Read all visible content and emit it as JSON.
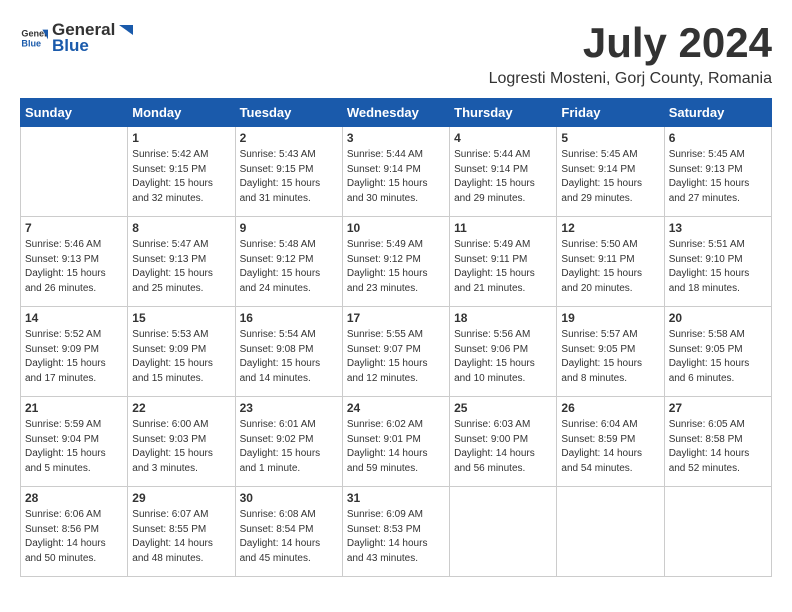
{
  "header": {
    "logo_general": "General",
    "logo_blue": "Blue",
    "month": "July 2024",
    "location": "Logresti Mosteni, Gorj County, Romania"
  },
  "days_of_week": [
    "Sunday",
    "Monday",
    "Tuesday",
    "Wednesday",
    "Thursday",
    "Friday",
    "Saturday"
  ],
  "weeks": [
    [
      {
        "day": "",
        "content": ""
      },
      {
        "day": "1",
        "content": "Sunrise: 5:42 AM\nSunset: 9:15 PM\nDaylight: 15 hours\nand 32 minutes."
      },
      {
        "day": "2",
        "content": "Sunrise: 5:43 AM\nSunset: 9:15 PM\nDaylight: 15 hours\nand 31 minutes."
      },
      {
        "day": "3",
        "content": "Sunrise: 5:44 AM\nSunset: 9:14 PM\nDaylight: 15 hours\nand 30 minutes."
      },
      {
        "day": "4",
        "content": "Sunrise: 5:44 AM\nSunset: 9:14 PM\nDaylight: 15 hours\nand 29 minutes."
      },
      {
        "day": "5",
        "content": "Sunrise: 5:45 AM\nSunset: 9:14 PM\nDaylight: 15 hours\nand 29 minutes."
      },
      {
        "day": "6",
        "content": "Sunrise: 5:45 AM\nSunset: 9:13 PM\nDaylight: 15 hours\nand 27 minutes."
      }
    ],
    [
      {
        "day": "7",
        "content": "Sunrise: 5:46 AM\nSunset: 9:13 PM\nDaylight: 15 hours\nand 26 minutes."
      },
      {
        "day": "8",
        "content": "Sunrise: 5:47 AM\nSunset: 9:13 PM\nDaylight: 15 hours\nand 25 minutes."
      },
      {
        "day": "9",
        "content": "Sunrise: 5:48 AM\nSunset: 9:12 PM\nDaylight: 15 hours\nand 24 minutes."
      },
      {
        "day": "10",
        "content": "Sunrise: 5:49 AM\nSunset: 9:12 PM\nDaylight: 15 hours\nand 23 minutes."
      },
      {
        "day": "11",
        "content": "Sunrise: 5:49 AM\nSunset: 9:11 PM\nDaylight: 15 hours\nand 21 minutes."
      },
      {
        "day": "12",
        "content": "Sunrise: 5:50 AM\nSunset: 9:11 PM\nDaylight: 15 hours\nand 20 minutes."
      },
      {
        "day": "13",
        "content": "Sunrise: 5:51 AM\nSunset: 9:10 PM\nDaylight: 15 hours\nand 18 minutes."
      }
    ],
    [
      {
        "day": "14",
        "content": "Sunrise: 5:52 AM\nSunset: 9:09 PM\nDaylight: 15 hours\nand 17 minutes."
      },
      {
        "day": "15",
        "content": "Sunrise: 5:53 AM\nSunset: 9:09 PM\nDaylight: 15 hours\nand 15 minutes."
      },
      {
        "day": "16",
        "content": "Sunrise: 5:54 AM\nSunset: 9:08 PM\nDaylight: 15 hours\nand 14 minutes."
      },
      {
        "day": "17",
        "content": "Sunrise: 5:55 AM\nSunset: 9:07 PM\nDaylight: 15 hours\nand 12 minutes."
      },
      {
        "day": "18",
        "content": "Sunrise: 5:56 AM\nSunset: 9:06 PM\nDaylight: 15 hours\nand 10 minutes."
      },
      {
        "day": "19",
        "content": "Sunrise: 5:57 AM\nSunset: 9:05 PM\nDaylight: 15 hours\nand 8 minutes."
      },
      {
        "day": "20",
        "content": "Sunrise: 5:58 AM\nSunset: 9:05 PM\nDaylight: 15 hours\nand 6 minutes."
      }
    ],
    [
      {
        "day": "21",
        "content": "Sunrise: 5:59 AM\nSunset: 9:04 PM\nDaylight: 15 hours\nand 5 minutes."
      },
      {
        "day": "22",
        "content": "Sunrise: 6:00 AM\nSunset: 9:03 PM\nDaylight: 15 hours\nand 3 minutes."
      },
      {
        "day": "23",
        "content": "Sunrise: 6:01 AM\nSunset: 9:02 PM\nDaylight: 15 hours\nand 1 minute."
      },
      {
        "day": "24",
        "content": "Sunrise: 6:02 AM\nSunset: 9:01 PM\nDaylight: 14 hours\nand 59 minutes."
      },
      {
        "day": "25",
        "content": "Sunrise: 6:03 AM\nSunset: 9:00 PM\nDaylight: 14 hours\nand 56 minutes."
      },
      {
        "day": "26",
        "content": "Sunrise: 6:04 AM\nSunset: 8:59 PM\nDaylight: 14 hours\nand 54 minutes."
      },
      {
        "day": "27",
        "content": "Sunrise: 6:05 AM\nSunset: 8:58 PM\nDaylight: 14 hours\nand 52 minutes."
      }
    ],
    [
      {
        "day": "28",
        "content": "Sunrise: 6:06 AM\nSunset: 8:56 PM\nDaylight: 14 hours\nand 50 minutes."
      },
      {
        "day": "29",
        "content": "Sunrise: 6:07 AM\nSunset: 8:55 PM\nDaylight: 14 hours\nand 48 minutes."
      },
      {
        "day": "30",
        "content": "Sunrise: 6:08 AM\nSunset: 8:54 PM\nDaylight: 14 hours\nand 45 minutes."
      },
      {
        "day": "31",
        "content": "Sunrise: 6:09 AM\nSunset: 8:53 PM\nDaylight: 14 hours\nand 43 minutes."
      },
      {
        "day": "",
        "content": ""
      },
      {
        "day": "",
        "content": ""
      },
      {
        "day": "",
        "content": ""
      }
    ]
  ]
}
